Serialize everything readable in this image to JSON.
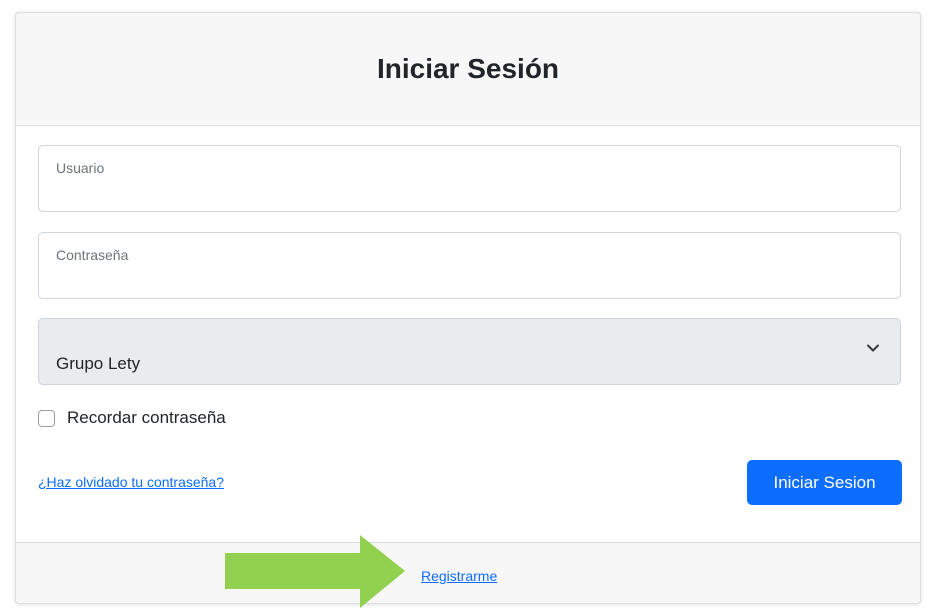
{
  "header": {
    "title": "Iniciar Sesión"
  },
  "form": {
    "username": {
      "label": "Usuario",
      "value": ""
    },
    "password": {
      "label": "Contraseña",
      "value": ""
    },
    "group_select": {
      "selected": "Grupo Lety"
    },
    "remember": {
      "label": "Recordar contraseña",
      "checked": false
    },
    "forgot_link": "¿Haz olvidado tu contraseña?",
    "submit_label": "Iniciar Sesion"
  },
  "footer": {
    "register_link": "Registrarme"
  },
  "icons": {
    "select_chevron": "chevron-down-icon",
    "annotation_arrow": "arrow-right-icon"
  },
  "colors": {
    "primary": "#0d6efd",
    "arrow": "#92d050",
    "header_bg": "#f7f7f7",
    "select_bg": "#e9ecef"
  }
}
